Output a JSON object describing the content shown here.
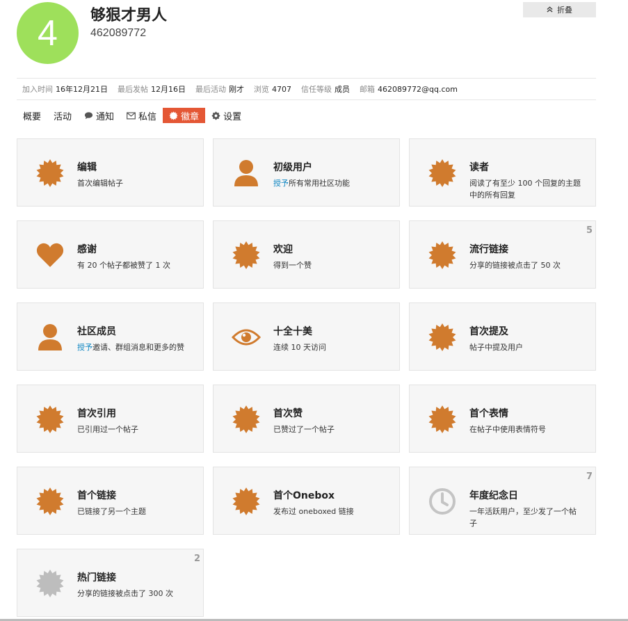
{
  "profile": {
    "avatar_letter": "4",
    "avatar_color": "#9ee05b",
    "name": "够狠才男人",
    "id": "462089772",
    "collapse_label": "折叠",
    "collapse_icon": "double-chevron-up-icon"
  },
  "stats": [
    {
      "key": "加入时间",
      "value": "16年12月21日"
    },
    {
      "key": "最后发帖",
      "value": "12月16日"
    },
    {
      "key": "最后活动",
      "value": "刚才"
    },
    {
      "key": "浏览",
      "value": "4707"
    },
    {
      "key": "信任等级",
      "value": "成员"
    },
    {
      "key": "邮箱",
      "value": "462089772@qq.com"
    }
  ],
  "nav": [
    {
      "label": "概要",
      "icon": ""
    },
    {
      "label": "活动",
      "icon": ""
    },
    {
      "label": "通知",
      "icon": "comment-icon"
    },
    {
      "label": "私信",
      "icon": "envelope-icon"
    },
    {
      "label": "徽章",
      "icon": "badge-icon",
      "active": true
    },
    {
      "label": "设置",
      "icon": "gear-icon"
    }
  ],
  "accent_color": "#e45735",
  "badge_color": "#d07b2e",
  "badges": [
    {
      "name": "编辑",
      "desc": "首次编辑帖子",
      "icon": "certificate",
      "count": ""
    },
    {
      "name": "初级用户",
      "link": "授予",
      "desc": "所有常用社区功能",
      "icon": "user",
      "count": ""
    },
    {
      "name": "读者",
      "desc": "阅读了有至少 100 个回复的主题中的所有回复",
      "icon": "certificate",
      "count": ""
    },
    {
      "name": "感谢",
      "desc": "有 20 个帖子都被赞了 1 次",
      "icon": "heart",
      "count": ""
    },
    {
      "name": "欢迎",
      "desc": "得到一个赞",
      "icon": "certificate",
      "count": ""
    },
    {
      "name": "流行链接",
      "desc": "分享的链接被点击了 50 次",
      "icon": "certificate",
      "count": "5"
    },
    {
      "name": "社区成员",
      "link": "授予",
      "desc": "邀请、群组消息和更多的赞",
      "icon": "user",
      "count": ""
    },
    {
      "name": "十全十美",
      "desc": "连续 10 天访问",
      "icon": "eye",
      "count": ""
    },
    {
      "name": "首次提及",
      "desc": "帖子中提及用户",
      "icon": "certificate",
      "count": ""
    },
    {
      "name": "首次引用",
      "desc": "已引用过一个帖子",
      "icon": "certificate",
      "count": ""
    },
    {
      "name": "首次赞",
      "desc": "已赞过了一个帖子",
      "icon": "certificate",
      "count": ""
    },
    {
      "name": "首个表情",
      "desc": "在帖子中使用表情符号",
      "icon": "certificate",
      "count": ""
    },
    {
      "name": "首个链接",
      "desc": "已链接了另一个主题",
      "icon": "certificate",
      "count": ""
    },
    {
      "name": "首个Onebox",
      "desc": "发布过 oneboxed 链接",
      "icon": "certificate",
      "count": ""
    },
    {
      "name": "年度纪念日",
      "desc": "一年活跃用户，至少发了一个帖子",
      "icon": "clock",
      "count": "7"
    },
    {
      "name": "热门链接",
      "desc": "分享的链接被点击了 300 次",
      "icon": "certificate-gray",
      "count": "2"
    }
  ]
}
